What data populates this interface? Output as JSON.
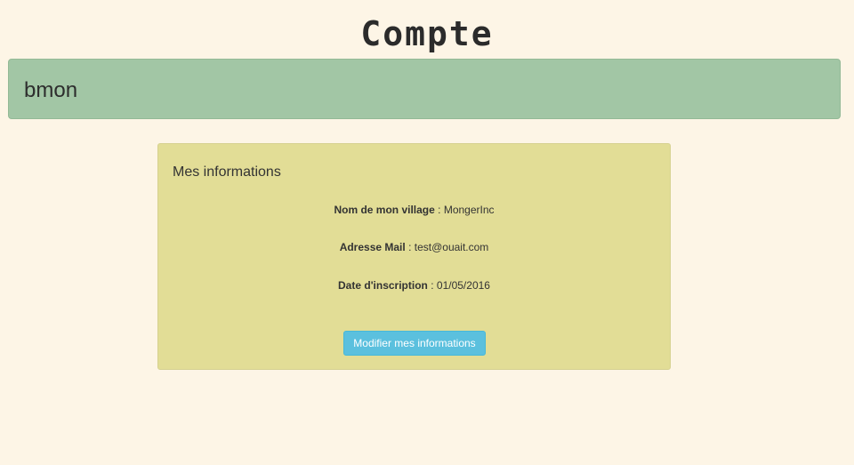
{
  "page": {
    "title": "Compte"
  },
  "banner": {
    "username": "bmon"
  },
  "info_panel": {
    "title": "Mes informations",
    "rows": [
      {
        "label": "Nom de mon village",
        "separator": " : ",
        "value": "MongerInc"
      },
      {
        "label": "Adresse Mail",
        "separator": " : ",
        "value": "test@ouait.com"
      },
      {
        "label": "Date d'inscription",
        "separator": " : ",
        "value": "01/05/2016"
      }
    ],
    "edit_button_label": "Modifier mes informations"
  },
  "colors": {
    "background": "#fdf5e6",
    "banner": "#a2c6a5",
    "panel": "#e2dd96",
    "button": "#5bc0de"
  }
}
